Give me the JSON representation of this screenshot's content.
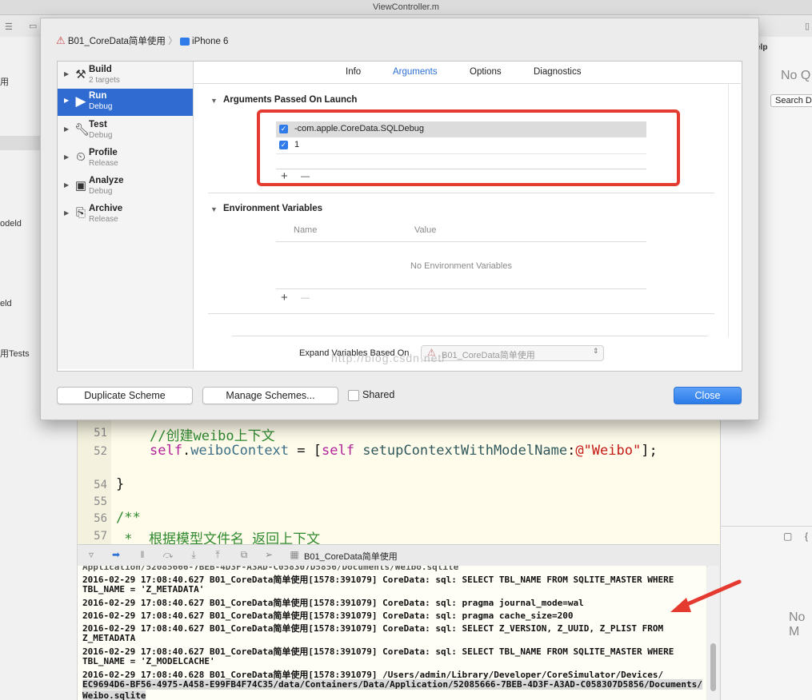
{
  "window": {
    "title": "ViewController.m"
  },
  "left_nav": {
    "fragments": [
      "用",
      "odeld",
      "eld",
      "用Tests"
    ]
  },
  "right_panel": {
    "help_label": "elp",
    "no_quick": "No Q",
    "search_label": "Search D",
    "no_m": "No M"
  },
  "scheme_path": {
    "project": "B01_CoreData简单使用",
    "destination": "iPhone 6"
  },
  "actions": [
    {
      "name": "Build",
      "sub": "2 targets",
      "icon": "hammer-icon"
    },
    {
      "name": "Run",
      "sub": "Debug",
      "icon": "play-icon",
      "selected": true
    },
    {
      "name": "Test",
      "sub": "Debug",
      "icon": "wrench-icon"
    },
    {
      "name": "Profile",
      "sub": "Release",
      "icon": "gauge-icon"
    },
    {
      "name": "Analyze",
      "sub": "Debug",
      "icon": "analyze-icon"
    },
    {
      "name": "Archive",
      "sub": "Release",
      "icon": "archive-icon"
    }
  ],
  "tabs": [
    "Info",
    "Arguments",
    "Options",
    "Diagnostics"
  ],
  "active_tab": "Arguments",
  "arguments": {
    "title": "Arguments Passed On Launch",
    "rows": [
      {
        "checked": true,
        "value": "-com.apple.CoreData.SQLDebug"
      },
      {
        "checked": true,
        "value": "1"
      }
    ],
    "add": "+",
    "remove": "—"
  },
  "environment": {
    "title": "Environment Variables",
    "col_name": "Name",
    "col_value": "Value",
    "empty": "No Environment Variables",
    "add": "+",
    "remove": "—"
  },
  "expand": {
    "label": "Expand Variables Based On",
    "value": "B01_CoreData简单使用"
  },
  "watermark": "http://blog.csdn.net/",
  "buttons": {
    "duplicate": "Duplicate Scheme",
    "manage": "Manage Schemes...",
    "shared": "Shared",
    "close": "Close"
  },
  "code": {
    "lines": [
      {
        "n": "51",
        "comment": "//创建weibo上下文"
      },
      {
        "n": "52",
        "self": "self",
        "dot": ".",
        "prop": "weiboContext",
        "eq": " = [",
        "self2": "self",
        "sp": " ",
        "method": "setupContextWithModelName",
        "colon": ":",
        "str": "@\"Weibo\"",
        "end": "];"
      },
      {
        "n": "54",
        "text": "}"
      },
      {
        "n": "55",
        "text": ""
      },
      {
        "n": "56",
        "comment": "/**"
      },
      {
        "n": "57",
        "comment": " *  根据模型文件名 返回上下文"
      }
    ]
  },
  "debug_bar": {
    "target": "B01_CoreData简单使用"
  },
  "console": {
    "lines": [
      "Application/52085666-7BEB-4D3F-A3AD-C058307D5856/Documents/Weibo.sqlite",
      "2016-02-29 17:08:40.627 B01_CoreData简单使用[1578:391079] CoreData: sql: SELECT TBL_NAME FROM SQLITE_MASTER WHERE",
      "TBL_NAME = 'Z_METADATA'",
      "2016-02-29 17:08:40.627 B01_CoreData简单使用[1578:391079] CoreData: sql: pragma journal_mode=wal",
      "2016-02-29 17:08:40.627 B01_CoreData简单使用[1578:391079] CoreData: sql: pragma cache_size=200",
      "2016-02-29 17:08:40.627 B01_CoreData简单使用[1578:391079] CoreData: sql: SELECT Z_VERSION, Z_UUID, Z_PLIST FROM",
      "Z_METADATA",
      "2016-02-29 17:08:40.627 B01_CoreData简单使用[1578:391079] CoreData: sql: SELECT TBL_NAME FROM SQLITE_MASTER WHERE",
      "TBL_NAME = 'Z_MODELCACHE'",
      "2016-02-29 17:08:40.628 B01_CoreData简单使用[1578:391079] /Users/admin/Library/Developer/CoreSimulator/Devices/",
      "EC9694D6-BF56-4975-A458-E99FB4F74C35/data/Containers/Data/Application/52085666-7BEB-4D3F-A3AD-C058307D5856/Documents/",
      "Weibo.sqlite"
    ]
  },
  "colors": {
    "accent": "#2f6bd1",
    "annotation": "#e53a2f"
  }
}
